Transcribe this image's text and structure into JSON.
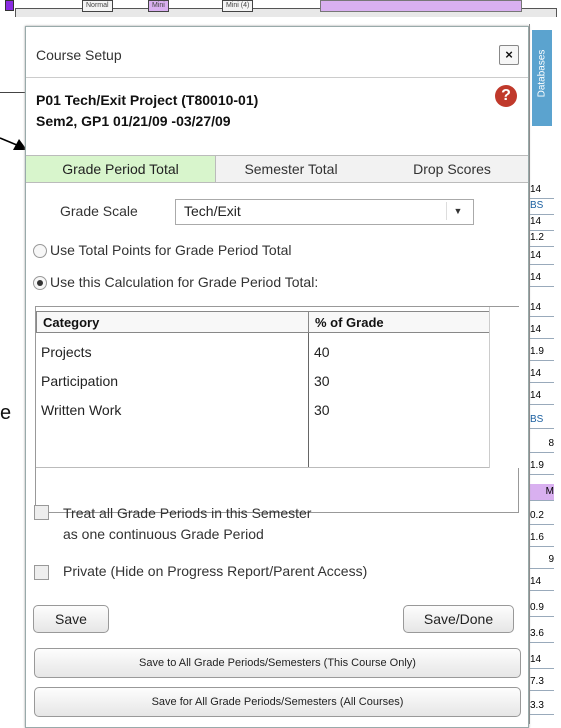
{
  "background": {
    "top_tabs": [
      "Normal",
      "Mini",
      "Mini (4)"
    ],
    "databases_tab": "Databases",
    "side_values": [
      "14",
      "BS",
      "14",
      "1.2",
      "14",
      "14",
      "14",
      "14",
      "1.9",
      "14",
      "14",
      "BS",
      "8",
      "1.9",
      "M",
      "0.2",
      "1.6",
      "9",
      "14",
      "0.9",
      "3.6",
      "14",
      "7.3",
      "3.3"
    ],
    "partial_text": "e"
  },
  "dialog": {
    "title": "Course Setup",
    "close_glyph": "×",
    "help_glyph": "?",
    "course_line1": "P01  Tech/Exit Project (T80010-01)",
    "course_line2": "Sem2, GP1  01/21/09  -03/27/09",
    "tabs": [
      {
        "label": "Grade Period Total",
        "active": true
      },
      {
        "label": "Semester Total",
        "active": false
      },
      {
        "label": "Drop Scores",
        "active": false
      }
    ],
    "grade_scale_label": "Grade Scale",
    "grade_scale_value": "Tech/Exit",
    "radio_total_points": "Use Total Points for Grade Period Total",
    "radio_calculation": "Use this Calculation for Grade Period Total:",
    "selected_option": "calculation",
    "table": {
      "headers": [
        "Category",
        "% of Grade"
      ],
      "rows": [
        {
          "category": "Projects",
          "percent": "40"
        },
        {
          "category": "Participation",
          "percent": "30"
        },
        {
          "category": "Written Work",
          "percent": "30"
        }
      ]
    },
    "treat_all_line1": "Treat all Grade Periods in this Semester",
    "treat_all_line2": "as one continuous Grade Period",
    "private_label": "Private (Hide on Progress Report/Parent Access)",
    "save_label": "Save",
    "save_done_label": "Save/Done",
    "save_all_periods_label": "Save to All Grade Periods/Semesters (This Course Only)",
    "save_all_courses_label": "Save for All Grade Periods/Semesters (All Courses)"
  }
}
